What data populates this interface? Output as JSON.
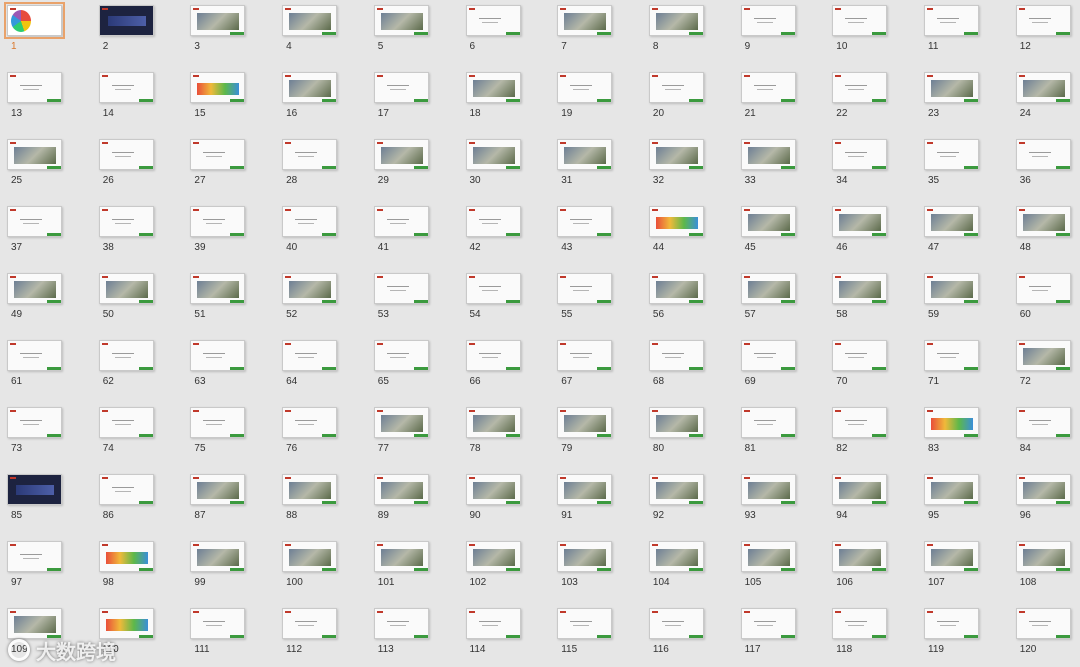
{
  "selected_slide": "1",
  "watermark_text": "大数跨境",
  "colors": {
    "selection": "#e9a26a",
    "accent_bar": "#3b9a3e",
    "background": "#e6e6e6"
  },
  "slides": [
    {
      "number": "1",
      "style": "cover"
    },
    {
      "number": "2",
      "style": "dark"
    },
    {
      "number": "3",
      "style": "img"
    },
    {
      "number": "4",
      "style": "img"
    },
    {
      "number": "5",
      "style": "img"
    },
    {
      "number": "6",
      "style": "text"
    },
    {
      "number": "7",
      "style": "img"
    },
    {
      "number": "8",
      "style": "img"
    },
    {
      "number": "9",
      "style": "text"
    },
    {
      "number": "10",
      "style": "text"
    },
    {
      "number": "11",
      "style": "text"
    },
    {
      "number": "12",
      "style": "text"
    },
    {
      "number": "13",
      "style": "text"
    },
    {
      "number": "14",
      "style": "text"
    },
    {
      "number": "15",
      "style": "color"
    },
    {
      "number": "16",
      "style": "img"
    },
    {
      "number": "17",
      "style": "text"
    },
    {
      "number": "18",
      "style": "img"
    },
    {
      "number": "19",
      "style": "text"
    },
    {
      "number": "20",
      "style": "text"
    },
    {
      "number": "21",
      "style": "text"
    },
    {
      "number": "22",
      "style": "text"
    },
    {
      "number": "23",
      "style": "img"
    },
    {
      "number": "24",
      "style": "img"
    },
    {
      "number": "25",
      "style": "img"
    },
    {
      "number": "26",
      "style": "text"
    },
    {
      "number": "27",
      "style": "text"
    },
    {
      "number": "28",
      "style": "text"
    },
    {
      "number": "29",
      "style": "img"
    },
    {
      "number": "30",
      "style": "img"
    },
    {
      "number": "31",
      "style": "img"
    },
    {
      "number": "32",
      "style": "img"
    },
    {
      "number": "33",
      "style": "img"
    },
    {
      "number": "34",
      "style": "text"
    },
    {
      "number": "35",
      "style": "text"
    },
    {
      "number": "36",
      "style": "text"
    },
    {
      "number": "37",
      "style": "text"
    },
    {
      "number": "38",
      "style": "text"
    },
    {
      "number": "39",
      "style": "text"
    },
    {
      "number": "40",
      "style": "text"
    },
    {
      "number": "41",
      "style": "text"
    },
    {
      "number": "42",
      "style": "text"
    },
    {
      "number": "43",
      "style": "text"
    },
    {
      "number": "44",
      "style": "color"
    },
    {
      "number": "45",
      "style": "img"
    },
    {
      "number": "46",
      "style": "img"
    },
    {
      "number": "47",
      "style": "img"
    },
    {
      "number": "48",
      "style": "img"
    },
    {
      "number": "49",
      "style": "img"
    },
    {
      "number": "50",
      "style": "img"
    },
    {
      "number": "51",
      "style": "img"
    },
    {
      "number": "52",
      "style": "img"
    },
    {
      "number": "53",
      "style": "text"
    },
    {
      "number": "54",
      "style": "text"
    },
    {
      "number": "55",
      "style": "text"
    },
    {
      "number": "56",
      "style": "img"
    },
    {
      "number": "57",
      "style": "img"
    },
    {
      "number": "58",
      "style": "img"
    },
    {
      "number": "59",
      "style": "img"
    },
    {
      "number": "60",
      "style": "text"
    },
    {
      "number": "61",
      "style": "text"
    },
    {
      "number": "62",
      "style": "text"
    },
    {
      "number": "63",
      "style": "text"
    },
    {
      "number": "64",
      "style": "text"
    },
    {
      "number": "65",
      "style": "text"
    },
    {
      "number": "66",
      "style": "text"
    },
    {
      "number": "67",
      "style": "text"
    },
    {
      "number": "68",
      "style": "text"
    },
    {
      "number": "69",
      "style": "text"
    },
    {
      "number": "70",
      "style": "text"
    },
    {
      "number": "71",
      "style": "text"
    },
    {
      "number": "72",
      "style": "img"
    },
    {
      "number": "73",
      "style": "text"
    },
    {
      "number": "74",
      "style": "text"
    },
    {
      "number": "75",
      "style": "text"
    },
    {
      "number": "76",
      "style": "text"
    },
    {
      "number": "77",
      "style": "img"
    },
    {
      "number": "78",
      "style": "img"
    },
    {
      "number": "79",
      "style": "img"
    },
    {
      "number": "80",
      "style": "img"
    },
    {
      "number": "81",
      "style": "text"
    },
    {
      "number": "82",
      "style": "text"
    },
    {
      "number": "83",
      "style": "color"
    },
    {
      "number": "84",
      "style": "text"
    },
    {
      "number": "85",
      "style": "dark"
    },
    {
      "number": "86",
      "style": "text"
    },
    {
      "number": "87",
      "style": "img"
    },
    {
      "number": "88",
      "style": "img"
    },
    {
      "number": "89",
      "style": "img"
    },
    {
      "number": "90",
      "style": "img"
    },
    {
      "number": "91",
      "style": "img"
    },
    {
      "number": "92",
      "style": "img"
    },
    {
      "number": "93",
      "style": "img"
    },
    {
      "number": "94",
      "style": "img"
    },
    {
      "number": "95",
      "style": "img"
    },
    {
      "number": "96",
      "style": "img"
    },
    {
      "number": "97",
      "style": "text"
    },
    {
      "number": "98",
      "style": "color"
    },
    {
      "number": "99",
      "style": "img"
    },
    {
      "number": "100",
      "style": "img"
    },
    {
      "number": "101",
      "style": "img"
    },
    {
      "number": "102",
      "style": "img"
    },
    {
      "number": "103",
      "style": "img"
    },
    {
      "number": "104",
      "style": "img"
    },
    {
      "number": "105",
      "style": "img"
    },
    {
      "number": "106",
      "style": "img"
    },
    {
      "number": "107",
      "style": "img"
    },
    {
      "number": "108",
      "style": "img"
    },
    {
      "number": "109",
      "style": "img"
    },
    {
      "number": "110",
      "style": "color"
    },
    {
      "number": "111",
      "style": "text"
    },
    {
      "number": "112",
      "style": "text"
    },
    {
      "number": "113",
      "style": "text"
    },
    {
      "number": "114",
      "style": "text"
    },
    {
      "number": "115",
      "style": "text"
    },
    {
      "number": "116",
      "style": "text"
    },
    {
      "number": "117",
      "style": "text"
    },
    {
      "number": "118",
      "style": "text"
    },
    {
      "number": "119",
      "style": "text"
    },
    {
      "number": "120",
      "style": "text"
    }
  ]
}
